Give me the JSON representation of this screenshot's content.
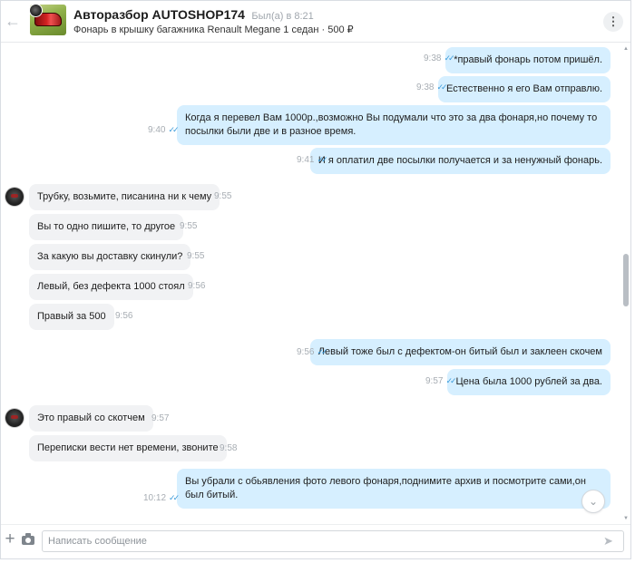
{
  "header": {
    "back_icon": "arrow-left-icon",
    "name": "Авторазбор AUTOSHOP174",
    "status": "Был(а) в 8:21",
    "listing": "Фонарь в крышку багажника Renault Megane 1 седан · 500 ₽",
    "menu_icon": "more-vertical-icon"
  },
  "messages": [
    {
      "dir": "out",
      "text": "*правый фонарь потом пришёл.",
      "time": "9:38"
    },
    {
      "dir": "out",
      "text": "Естественно я его Вам отправлю.",
      "time": "9:38"
    },
    {
      "dir": "out",
      "text": "Когда я перевел Вам 1000р.,возможно Вы подумали что это за два фонаря,но почему то посылки были две и в разное время.",
      "time": "9:40"
    },
    {
      "dir": "out",
      "text": "И я оплатил две посылки получается и за ненужный фонарь.",
      "time": "9:41"
    },
    {
      "dir": "in",
      "text": "Трубку, возьмите, писанина ни к чему",
      "time": "9:55"
    },
    {
      "dir": "in",
      "text": "Вы то одно пишите, то другое",
      "time": "9:55"
    },
    {
      "dir": "in",
      "text": "За какую вы доставку скинули?",
      "time": "9:55"
    },
    {
      "dir": "in",
      "text": "Левый, без дефекта 1000 стоял",
      "time": "9:56"
    },
    {
      "dir": "in",
      "text": "Правый за 500",
      "time": "9:56"
    },
    {
      "dir": "out",
      "text": "Левый тоже был с дефектом-он битый был и заклеен скочем",
      "time": "9:56"
    },
    {
      "dir": "out",
      "text": "Цена была 1000 рублей за два.",
      "time": "9:57"
    },
    {
      "dir": "in",
      "text": "Это правый со скотчем",
      "time": "9:57"
    },
    {
      "dir": "in",
      "text": "Переписки вести нет времени, звоните",
      "time": "9:58"
    },
    {
      "dir": "out",
      "text": "Вы убрали с обьявления фото левого фонаря,поднимите архив и посмотрите сами,он был битый.",
      "time": "10:12"
    }
  ],
  "read_checks": "✓✓",
  "composer": {
    "placeholder": "Написать сообщение",
    "attach_icon": "plus-icon",
    "camera_icon": "camera-icon",
    "send_icon": "send-icon"
  },
  "colors": {
    "outgoing_bubble": "#d6efff",
    "incoming_bubble": "#f1f2f4",
    "read_check": "#3a9ad9"
  }
}
